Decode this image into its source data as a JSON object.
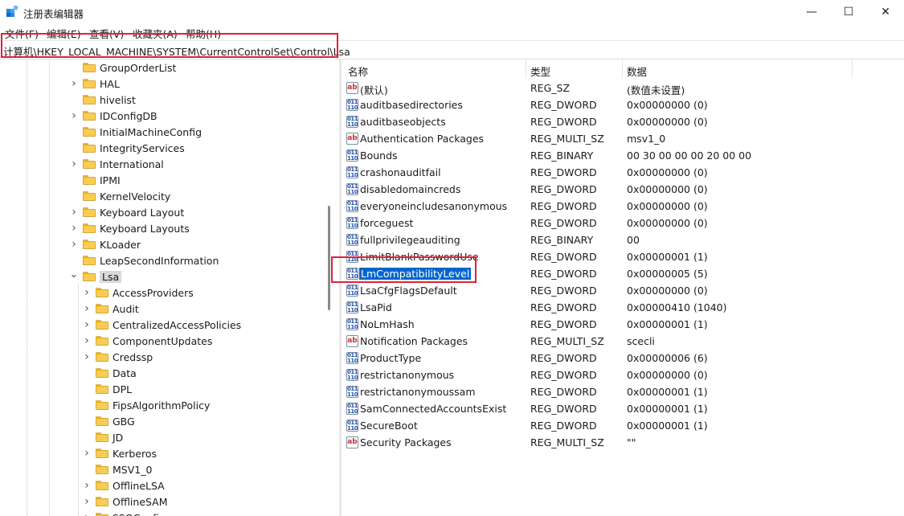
{
  "window": {
    "title": "注册表编辑器",
    "controls": {
      "minimize": "—",
      "maximize": "☐",
      "close": "✕"
    }
  },
  "menu": [
    "文件(F)",
    "编辑(E)",
    "查看(V)",
    "收藏夹(A)",
    "帮助(H)"
  ],
  "address": "计算机\\HKEY_LOCAL_MACHINE\\SYSTEM\\CurrentControlSet\\Control\\Lsa",
  "tree": {
    "items": [
      {
        "label": "GroupOrderList",
        "level": 1,
        "expander": "none"
      },
      {
        "label": "HAL",
        "level": 1,
        "expander": "collapsed"
      },
      {
        "label": "hivelist",
        "level": 1,
        "expander": "none"
      },
      {
        "label": "IDConfigDB",
        "level": 1,
        "expander": "collapsed"
      },
      {
        "label": "InitialMachineConfig",
        "level": 1,
        "expander": "none"
      },
      {
        "label": "IntegrityServices",
        "level": 1,
        "expander": "none"
      },
      {
        "label": "International",
        "level": 1,
        "expander": "collapsed"
      },
      {
        "label": "IPMI",
        "level": 1,
        "expander": "none"
      },
      {
        "label": "KernelVelocity",
        "level": 1,
        "expander": "none"
      },
      {
        "label": "Keyboard Layout",
        "level": 1,
        "expander": "collapsed"
      },
      {
        "label": "Keyboard Layouts",
        "level": 1,
        "expander": "collapsed"
      },
      {
        "label": "KLoader",
        "level": 1,
        "expander": "collapsed"
      },
      {
        "label": "LeapSecondInformation",
        "level": 1,
        "expander": "none"
      },
      {
        "label": "Lsa",
        "level": 1,
        "expander": "expanded",
        "selected": true
      },
      {
        "label": "AccessProviders",
        "level": 2,
        "expander": "collapsed"
      },
      {
        "label": "Audit",
        "level": 2,
        "expander": "collapsed"
      },
      {
        "label": "CentralizedAccessPolicies",
        "level": 2,
        "expander": "collapsed"
      },
      {
        "label": "ComponentUpdates",
        "level": 2,
        "expander": "collapsed"
      },
      {
        "label": "Credssp",
        "level": 2,
        "expander": "collapsed"
      },
      {
        "label": "Data",
        "level": 2,
        "expander": "none"
      },
      {
        "label": "DPL",
        "level": 2,
        "expander": "none"
      },
      {
        "label": "FipsAlgorithmPolicy",
        "level": 2,
        "expander": "none"
      },
      {
        "label": "GBG",
        "level": 2,
        "expander": "none"
      },
      {
        "label": "JD",
        "level": 2,
        "expander": "none"
      },
      {
        "label": "Kerberos",
        "level": 2,
        "expander": "collapsed"
      },
      {
        "label": "MSV1_0",
        "level": 2,
        "expander": "none"
      },
      {
        "label": "OfflineLSA",
        "level": 2,
        "expander": "collapsed"
      },
      {
        "label": "OfflineSAM",
        "level": 2,
        "expander": "collapsed"
      },
      {
        "label": "SSOConfig",
        "level": 2,
        "expander": "collapsed"
      }
    ]
  },
  "list": {
    "columns": {
      "name": "名称",
      "type": "类型",
      "data": "数据"
    },
    "rows": [
      {
        "icon": "string-value-icon",
        "name": "(默认)",
        "type": "REG_SZ",
        "data": "(数值未设置)"
      },
      {
        "icon": "binary-value-icon",
        "name": "auditbasedirectories",
        "type": "REG_DWORD",
        "data": "0x00000000 (0)"
      },
      {
        "icon": "binary-value-icon",
        "name": "auditbaseobjects",
        "type": "REG_DWORD",
        "data": "0x00000000 (0)"
      },
      {
        "icon": "string-value-icon",
        "name": "Authentication Packages",
        "type": "REG_MULTI_SZ",
        "data": "msv1_0"
      },
      {
        "icon": "binary-value-icon",
        "name": "Bounds",
        "type": "REG_BINARY",
        "data": "00 30 00 00 00 20 00 00"
      },
      {
        "icon": "binary-value-icon",
        "name": "crashonauditfail",
        "type": "REG_DWORD",
        "data": "0x00000000 (0)"
      },
      {
        "icon": "binary-value-icon",
        "name": "disabledomaincreds",
        "type": "REG_DWORD",
        "data": "0x00000000 (0)"
      },
      {
        "icon": "binary-value-icon",
        "name": "everyoneincludesanonymous",
        "type": "REG_DWORD",
        "data": "0x00000000 (0)"
      },
      {
        "icon": "binary-value-icon",
        "name": "forceguest",
        "type": "REG_DWORD",
        "data": "0x00000000 (0)"
      },
      {
        "icon": "binary-value-icon",
        "name": "fullprivilegeauditing",
        "type": "REG_BINARY",
        "data": "00"
      },
      {
        "icon": "binary-value-icon",
        "name": "LimitBlankPasswordUse",
        "type": "REG_DWORD",
        "data": "0x00000001 (1)"
      },
      {
        "icon": "binary-value-icon",
        "name": "LmCompatibilityLevel",
        "type": "REG_DWORD",
        "data": "0x00000005 (5)",
        "selected": true
      },
      {
        "icon": "binary-value-icon",
        "name": "LsaCfgFlagsDefault",
        "type": "REG_DWORD",
        "data": "0x00000000 (0)"
      },
      {
        "icon": "binary-value-icon",
        "name": "LsaPid",
        "type": "REG_DWORD",
        "data": "0x00000410 (1040)"
      },
      {
        "icon": "binary-value-icon",
        "name": "NoLmHash",
        "type": "REG_DWORD",
        "data": "0x00000001 (1)"
      },
      {
        "icon": "string-value-icon",
        "name": "Notification Packages",
        "type": "REG_MULTI_SZ",
        "data": "scecli"
      },
      {
        "icon": "binary-value-icon",
        "name": "ProductType",
        "type": "REG_DWORD",
        "data": "0x00000006 (6)"
      },
      {
        "icon": "binary-value-icon",
        "name": "restrictanonymous",
        "type": "REG_DWORD",
        "data": "0x00000000 (0)"
      },
      {
        "icon": "binary-value-icon",
        "name": "restrictanonymoussam",
        "type": "REG_DWORD",
        "data": "0x00000001 (1)"
      },
      {
        "icon": "binary-value-icon",
        "name": "SamConnectedAccountsExist",
        "type": "REG_DWORD",
        "data": "0x00000001 (1)"
      },
      {
        "icon": "binary-value-icon",
        "name": "SecureBoot",
        "type": "REG_DWORD",
        "data": "0x00000001 (1)"
      },
      {
        "icon": "string-value-icon",
        "name": "Security Packages",
        "type": "REG_MULTI_SZ",
        "data": "\"\""
      }
    ]
  },
  "colors": {
    "selection": "#0066cc",
    "highlight_box": "#e0203a",
    "tree_selected": "#d9d9d9"
  }
}
